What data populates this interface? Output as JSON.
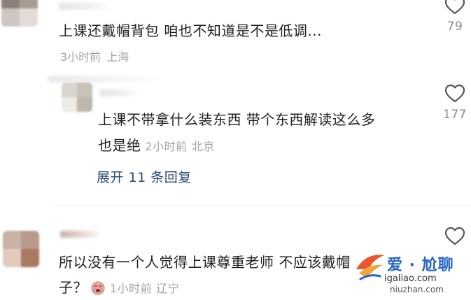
{
  "comments": [
    {
      "text": "上课还戴帽背包 咱也不知道是不是低调...",
      "time": "3小时前",
      "location": "上海",
      "likes": "79"
    },
    {
      "text_line1": "上课不带拿什么装东西 带个东西解读这么多",
      "text_line2": "也是绝",
      "time": "2小时前",
      "location": "北京",
      "likes": "177",
      "expand_label": "展开 11 条回复"
    },
    {
      "text_line1": "所以没有一个人觉得上课尊重老师 不应该戴帽",
      "text_line2": "子？",
      "emoji_icon": "crying-emoji-icon",
      "time": "1小时前",
      "location": "辽宁",
      "likes": ""
    }
  ],
  "watermark": {
    "title": "爱 · 尬聊",
    "url": "igaliao.com",
    "url2": "niuzhan.com"
  },
  "colors": {
    "text": "#1f1f1f",
    "meta": "#a3a3a3",
    "link": "#2c4a73",
    "watermark_blue": "#2463c9"
  }
}
